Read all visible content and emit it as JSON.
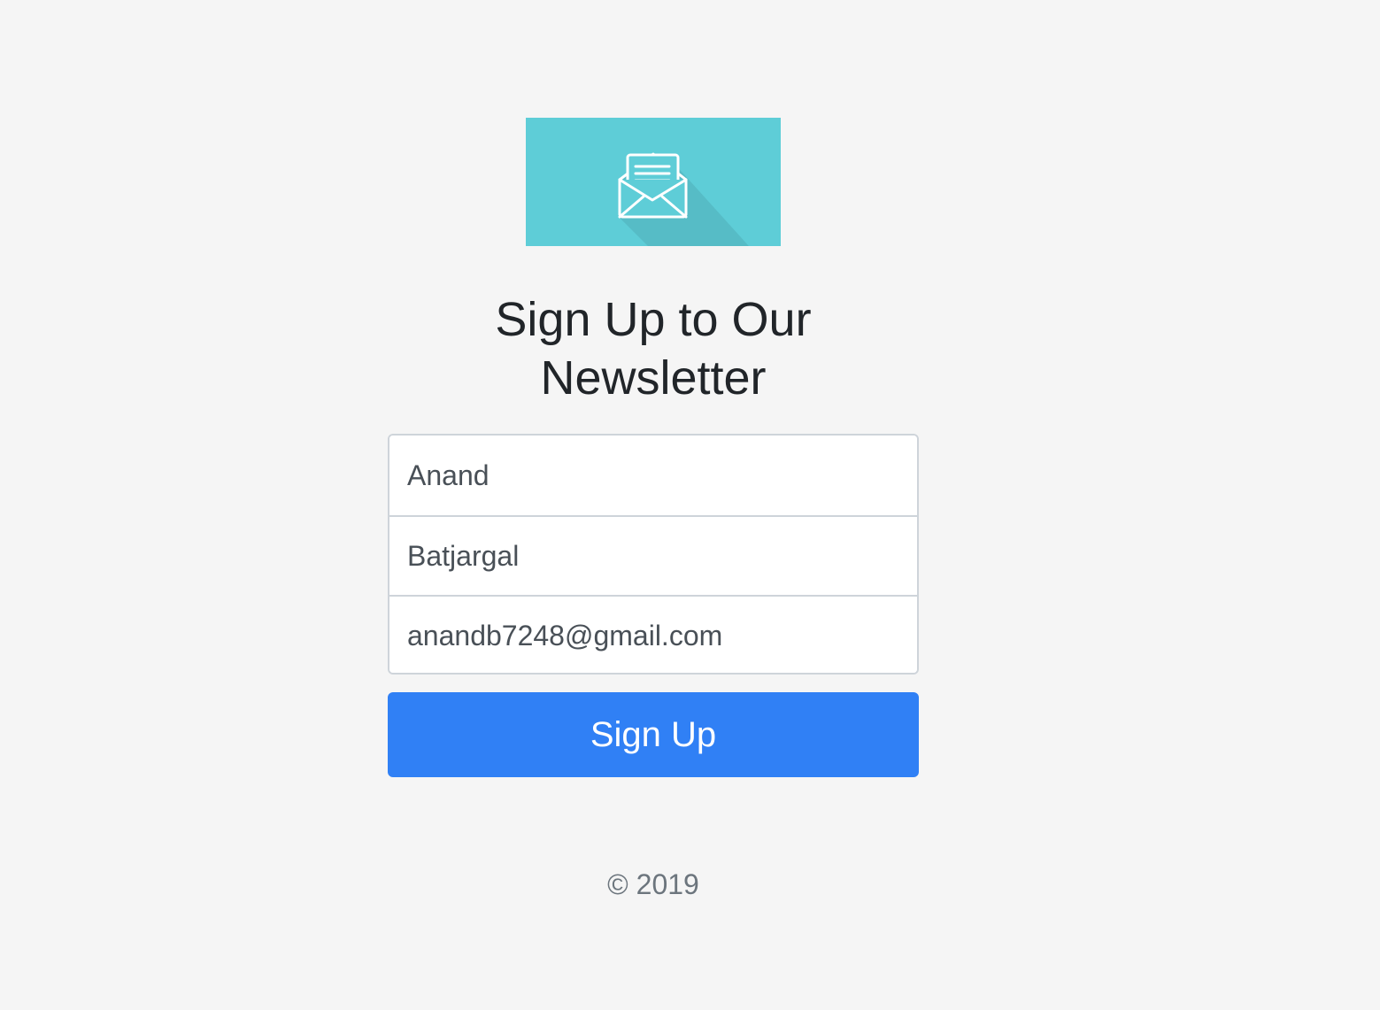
{
  "logo": {
    "icon": "open-envelope-letter-icon",
    "background_color": "#5ecdd7"
  },
  "heading": {
    "line1": "Sign Up to Our",
    "line2": "Newsletter"
  },
  "form": {
    "first_name": {
      "value": "Anand"
    },
    "last_name": {
      "value": "Batjargal"
    },
    "email": {
      "value": "anandb7248@gmail.com"
    },
    "submit_label": "Sign Up"
  },
  "footer": {
    "copyright": "© 2019"
  },
  "colors": {
    "page_background": "#f5f5f5",
    "button": "#3080f5",
    "heading_text": "#212529",
    "muted_text": "#6c757d"
  }
}
